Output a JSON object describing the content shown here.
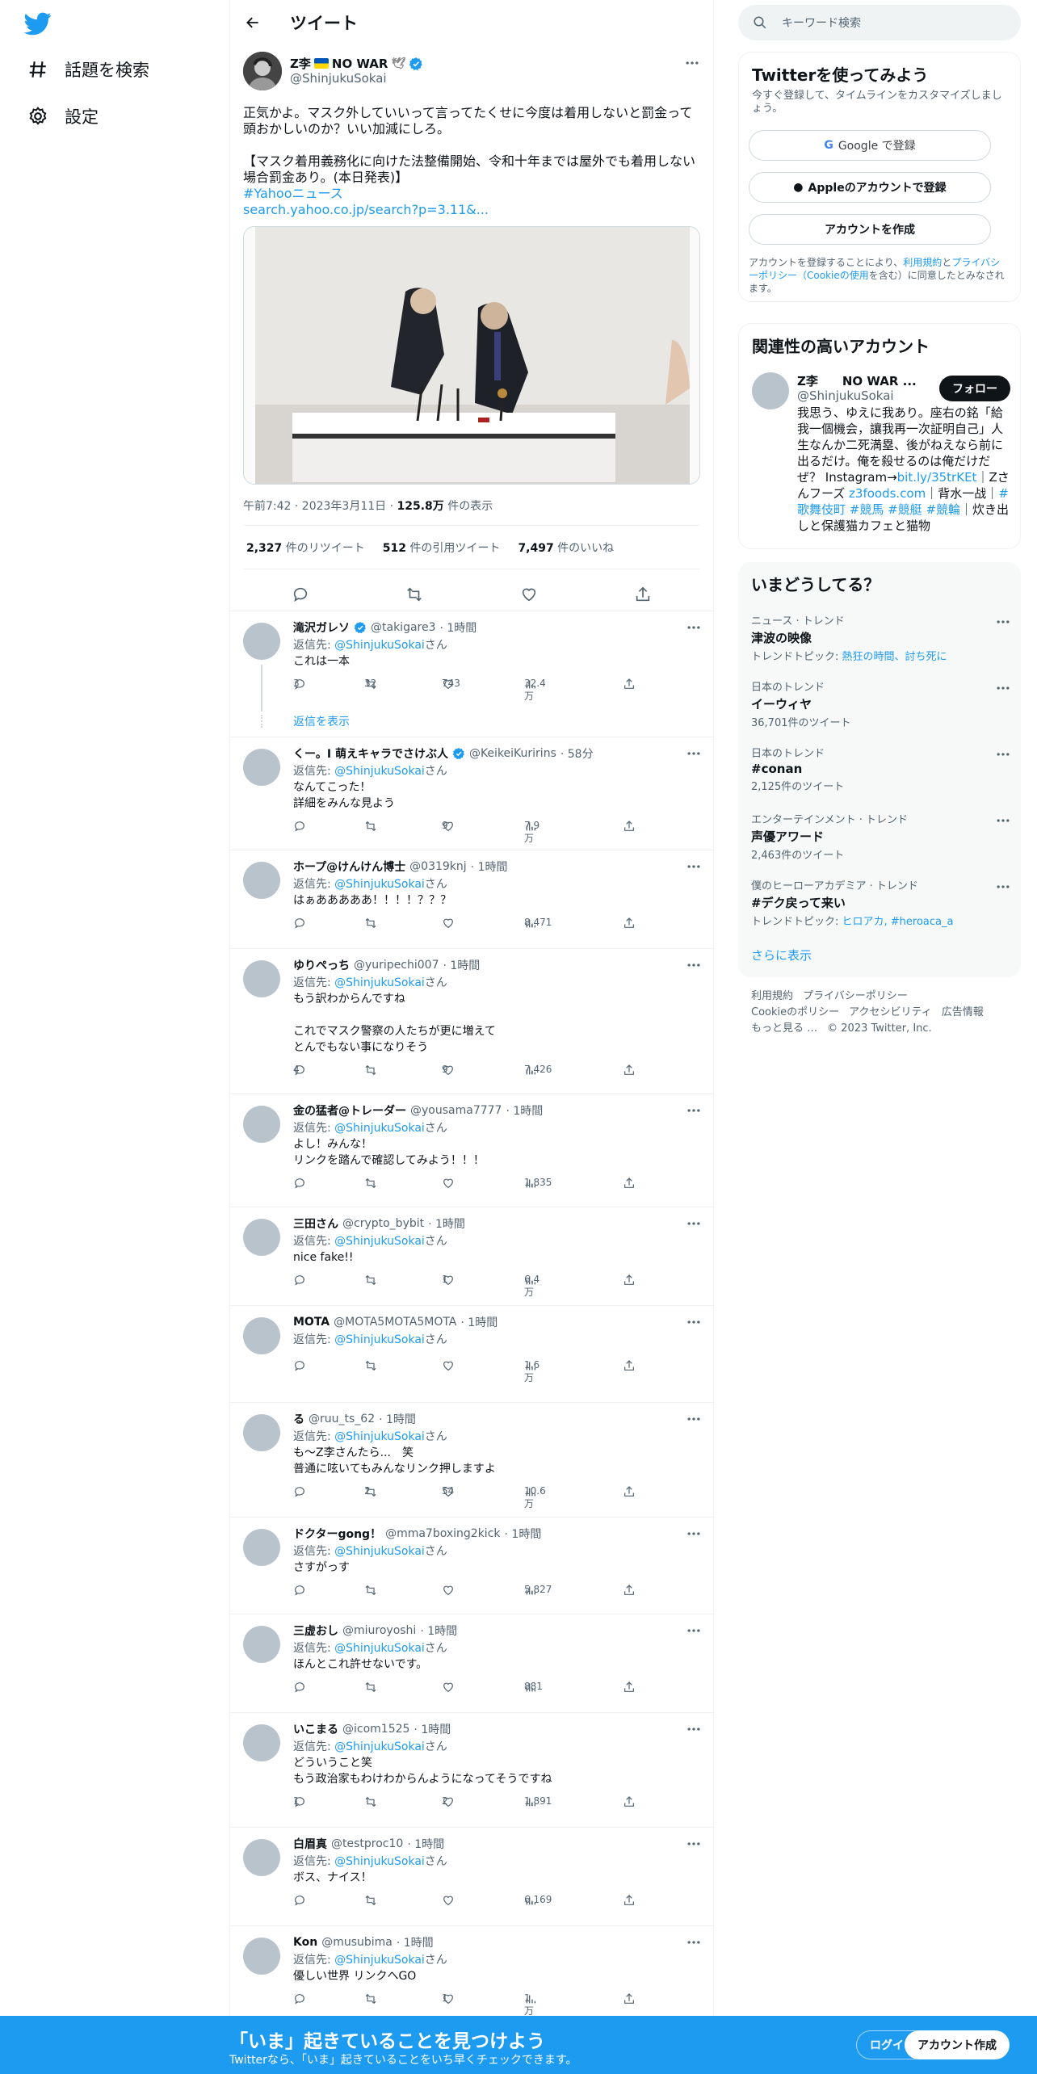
{
  "nav": {
    "explore": "話題を検索",
    "settings": "設定"
  },
  "header": {
    "title": "ツイート"
  },
  "tweet": {
    "name": "Z李",
    "name_suffix": "NO WAR",
    "handle": "@ShinjukuSokai",
    "text1": "正気かよ。マスク外していいって言ってたくせに今度は着用しないと罰金って頭おかしいのか？いい加減にしろ。",
    "text2": "【マスク着用義務化に向けた法整備開始、令和十年までは屋外でも着用しない場合罰金あり。(本日発表)】",
    "hashtag": "#Yahooニュース",
    "link": "search.yahoo.co.jp/search?p=3.11&...",
    "time": "午前7:42 · 2023年3月11日 · ",
    "views": "125.8万",
    "views_label": " 件の表示",
    "retweets": "2,327",
    "retweets_label": " 件のリツイート",
    "quotes": "512",
    "quotes_label": " 件の引用ツイート",
    "likes": "7,497",
    "likes_label": " 件のいいね"
  },
  "replies": [
    {
      "name": "滝沢ガレソ",
      "handle": "@takigare3",
      "time": "· 1時間",
      "rto": "返信先: ",
      "rto_user": "@ShinjukuSokai",
      "rto_suffix": "さん",
      "text": "これは一本",
      "reply": "3",
      "rt": "32",
      "like": "743",
      "views": "32.4万",
      "verified": true,
      "show_replies": "返信を表示"
    },
    {
      "name": "くー。I 萌えキャラでさけぶ人",
      "handle": "@KeikeiKuririns",
      "time": "· 58分",
      "rto": "返信先: ",
      "rto_user": "@ShinjukuSokai",
      "rto_suffix": "さん",
      "text": "なんてこった！\n詳細をみんな見よう",
      "reply": "",
      "rt": "",
      "like": "9",
      "views": "7.9万",
      "verified": true
    },
    {
      "name": "ホープ@けんけん博士",
      "handle": "@0319knj",
      "time": "· 1時間",
      "rto": "返信先: ",
      "rto_user": "@ShinjukuSokai",
      "rto_suffix": "さん",
      "text": "はぁあああああ！！！！？？？",
      "reply": "",
      "rt": "",
      "like": "",
      "views": "8,471"
    },
    {
      "name": "ゆりぺっち",
      "handle": "@yuripechi007",
      "time": "· 1時間",
      "rto": "返信先: ",
      "rto_user": "@ShinjukuSokai",
      "rto_suffix": "さん",
      "text": "もう訳わからんですね\n\nこれでマスク警察の人たちが更に増えて\nとんでもない事になりそう",
      "reply": "4",
      "rt": "",
      "like": "9",
      "views": "7,426"
    },
    {
      "name": "金の猛者@トレーダー",
      "handle": "@yousama7777",
      "time": "· 1時間",
      "rto": "返信先: ",
      "rto_user": "@ShinjukuSokai",
      "rto_suffix": "さん",
      "text": "よし！みんな！\nリンクを踏んで確認してみよう！！！",
      "reply": "",
      "rt": "",
      "like": "",
      "views": "1,835"
    },
    {
      "name": "三田さん",
      "handle": "@crypto_bybit",
      "time": "· 1時間",
      "rto": "返信先: ",
      "rto_user": "@ShinjukuSokai",
      "rto_suffix": "さん",
      "text": "nice fake!!",
      "reply": "",
      "rt": "",
      "like": "1",
      "views": "6.4万"
    },
    {
      "name": "MOTA",
      "handle": "@MOTA5MOTA5MOTA",
      "time": "· 1時間",
      "rto": "返信先: ",
      "rto_user": "@ShinjukuSokai",
      "rto_suffix": "さん",
      "text": "",
      "reply": "",
      "rt": "",
      "like": "",
      "views": "1.6万"
    },
    {
      "name": "る",
      "handle": "@ruu_ts_62",
      "time": "· 1時間",
      "rto": "返信先: ",
      "rto_user": "@ShinjukuSokai",
      "rto_suffix": "さん",
      "text": "も〜Z李さんたら...　笑\n普通に呟いてもみんなリンク押しますよ",
      "reply": "",
      "rt": "2",
      "like": "54",
      "views": "10.6万"
    },
    {
      "name": "ドクターgong！",
      "handle": "@mma7boxing2kick",
      "time": "· 1時間",
      "rto": "返信先: ",
      "rto_user": "@ShinjukuSokai",
      "rto_suffix": "さん",
      "text": "さすがっす",
      "reply": "",
      "rt": "",
      "like": "",
      "views": "5,827"
    },
    {
      "name": "三虚おし",
      "handle": "@miuroyoshi",
      "time": "· 1時間",
      "rto": "返信先: ",
      "rto_user": "@ShinjukuSokai",
      "rto_suffix": "さん",
      "text": "ほんとこれ許せないです。",
      "reply": "",
      "rt": "",
      "like": "",
      "views": "881"
    },
    {
      "name": "いこまる",
      "handle": "@icom1525",
      "time": "· 1時間",
      "rto": "返信先: ",
      "rto_user": "@ShinjukuSokai",
      "rto_suffix": "さん",
      "text": "どういうこと笑\nもう政治家もわけわからんようになってそうですね",
      "reply": "1",
      "rt": "",
      "like": "2",
      "views": "1,891"
    },
    {
      "name": "白眉真",
      "handle": "@testproc10",
      "time": "· 1時間",
      "rto": "返信先: ",
      "rto_user": "@ShinjukuSokai",
      "rto_suffix": "さん",
      "text": "ボス、ナイス！",
      "reply": "",
      "rt": "",
      "like": "",
      "views": "6,169"
    },
    {
      "name": "Kon",
      "handle": "@musubima",
      "time": "· 1時間",
      "rto": "返信先: ",
      "rto_user": "@ShinjukuSokai",
      "rto_suffix": "さん",
      "text": "優しい世界 リンクへGO",
      "reply": "",
      "rt": "",
      "like": "1",
      "views": "1万"
    }
  ],
  "search": {
    "placeholder": "キーワード検索"
  },
  "signup": {
    "title": "Twitterを使ってみよう",
    "desc": "今すぐ登録して、タイムラインをカスタマイズしましょう。",
    "google": "Google で登録",
    "apple": "Appleのアカウントで登録",
    "create": "アカウントを作成",
    "legal_1": "アカウントを登録することにより、",
    "legal_terms": "利用規約",
    "legal_2": "と",
    "legal_privacy": "プライバシーポリシー（Cookieの使用",
    "legal_3": "を含む）に同意したとみなされます。"
  },
  "related": {
    "title": "関連性の高いアカウント",
    "name": "Z李　　NO WAR ...",
    "handle": "@ShinjukuSokai",
    "follow": "フォロー",
    "bio_1": "我思う、ゆえに我あり。座右の銘「給我一個機会，讓我再一次証明自己」人生なんか二死満塁、後がねえなら前に出るだけ。俺を殺せるのは俺だけだぜ？ Instagram→",
    "bio_link1": "bit.ly/35trKEt",
    "bio_2": "｜Zさんフーズ ",
    "bio_link2": "z3foods.com",
    "bio_3": "｜背水一战｜",
    "bio_tags": "#歌舞伎町 #競馬 #競艇 #競輪",
    "bio_4": "｜炊き出しと保護猫カフェと猫物"
  },
  "trends": {
    "title": "いまどうしてる？",
    "items": [
      {
        "cat": "ニュース · トレンド",
        "title": "津波の映像",
        "sub": "トレンドトピック: ",
        "sub_link": "熱狂の時間、討ち死に"
      },
      {
        "cat": "日本のトレンド",
        "title": "イーウィヤ",
        "sub": "36,701件のツイート",
        "sub_link": ""
      },
      {
        "cat": "日本のトレンド",
        "title": "#conan",
        "sub": "2,125件のツイート",
        "sub_link": ""
      },
      {
        "cat": "エンターテインメント · トレンド",
        "title": "声優アワード",
        "sub": "2,463件のツイート",
        "sub_link": ""
      },
      {
        "cat": "僕のヒーローアカデミア · トレンド",
        "title": "#デク戻って来い",
        "sub": "トレンドトピック: ",
        "sub_link": "ヒロアカ, #heroaca_a"
      }
    ],
    "show_more": "さらに表示"
  },
  "footer": {
    "terms": "利用規約",
    "privacy": "プライバシーポリシー",
    "cookie": "Cookieのポリシー",
    "access": "アクセシビリティ",
    "ads": "広告情報",
    "more": "もっと見る …",
    "copyright": "© 2023 Twitter, Inc."
  },
  "bottom": {
    "title": "「いま」起きていることを見つけよう",
    "sub": "Twitterなら、「いま」起きていることをいち早くチェックできます。",
    "login": "ログイン",
    "signup": "アカウント作成"
  },
  "colors": {
    "accent": "#1d9bf0",
    "text": "#0f1419",
    "muted": "#536471"
  }
}
